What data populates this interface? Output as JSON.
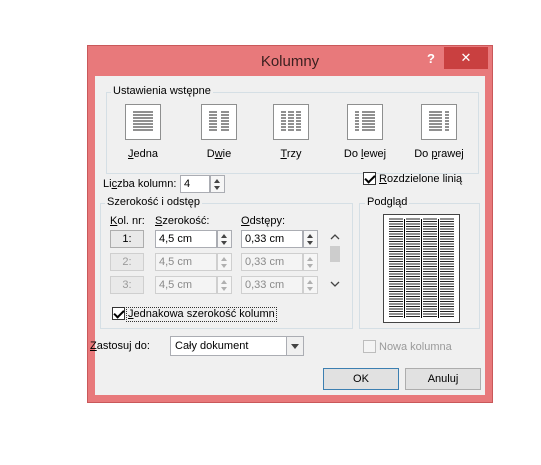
{
  "dialog": {
    "title": "Kolumny",
    "help_label": "?",
    "close_label": "✕"
  },
  "presets": {
    "group_label": "Ustawienia wstępne",
    "items": [
      {
        "label": "Jedna",
        "key": "J",
        "rest": "edna",
        "columns": 1
      },
      {
        "label": "Dwie",
        "pre": "D",
        "key": "w",
        "rest": "ie",
        "columns": 2
      },
      {
        "label": "Trzy",
        "key": "T",
        "rest": "rzy",
        "columns": 3
      },
      {
        "label": "Do lewej",
        "pre": "Do ",
        "key": "l",
        "rest": "ewej",
        "columns": "left"
      },
      {
        "label": "Do prawej",
        "pre": "Do ",
        "key": "p",
        "rest": "rawej",
        "columns": "right"
      }
    ]
  },
  "column_count": {
    "label_pre": "Li",
    "label_key": "c",
    "label_rest": "zba kolumn:",
    "value": "4"
  },
  "line_between": {
    "label_key": "R",
    "label_rest": "ozdzielone linią",
    "checked": true
  },
  "width_spacing": {
    "group_label": "Szerokość i odstęp",
    "col_header_key": "K",
    "col_header_rest": "ol. nr:",
    "width_header_key": "S",
    "width_header_rest": "zerokość:",
    "spacing_header_key": "O",
    "spacing_header_rest": "dstępy:",
    "rows": [
      {
        "num": "1:",
        "width": "4,5 cm",
        "spacing": "0,33 cm",
        "enabled": true
      },
      {
        "num": "2:",
        "width": "4,5 cm",
        "spacing": "0,33 cm",
        "enabled": false
      },
      {
        "num": "3:",
        "width": "4,5 cm",
        "spacing": "0,33 cm",
        "enabled": false
      }
    ],
    "equal_width_key": "J",
    "equal_width_rest": "ednakowa szerokość kolumn",
    "equal_width_checked": true
  },
  "preview": {
    "group_label": "Podgląd",
    "columns": 4
  },
  "apply_to": {
    "label_key": "Z",
    "label_rest": "astosuj do:",
    "value": "Cały dokument"
  },
  "new_column": {
    "label": "Nowa kolumna",
    "checked": false,
    "enabled": false
  },
  "buttons": {
    "ok": "OK",
    "cancel": "Anuluj"
  }
}
